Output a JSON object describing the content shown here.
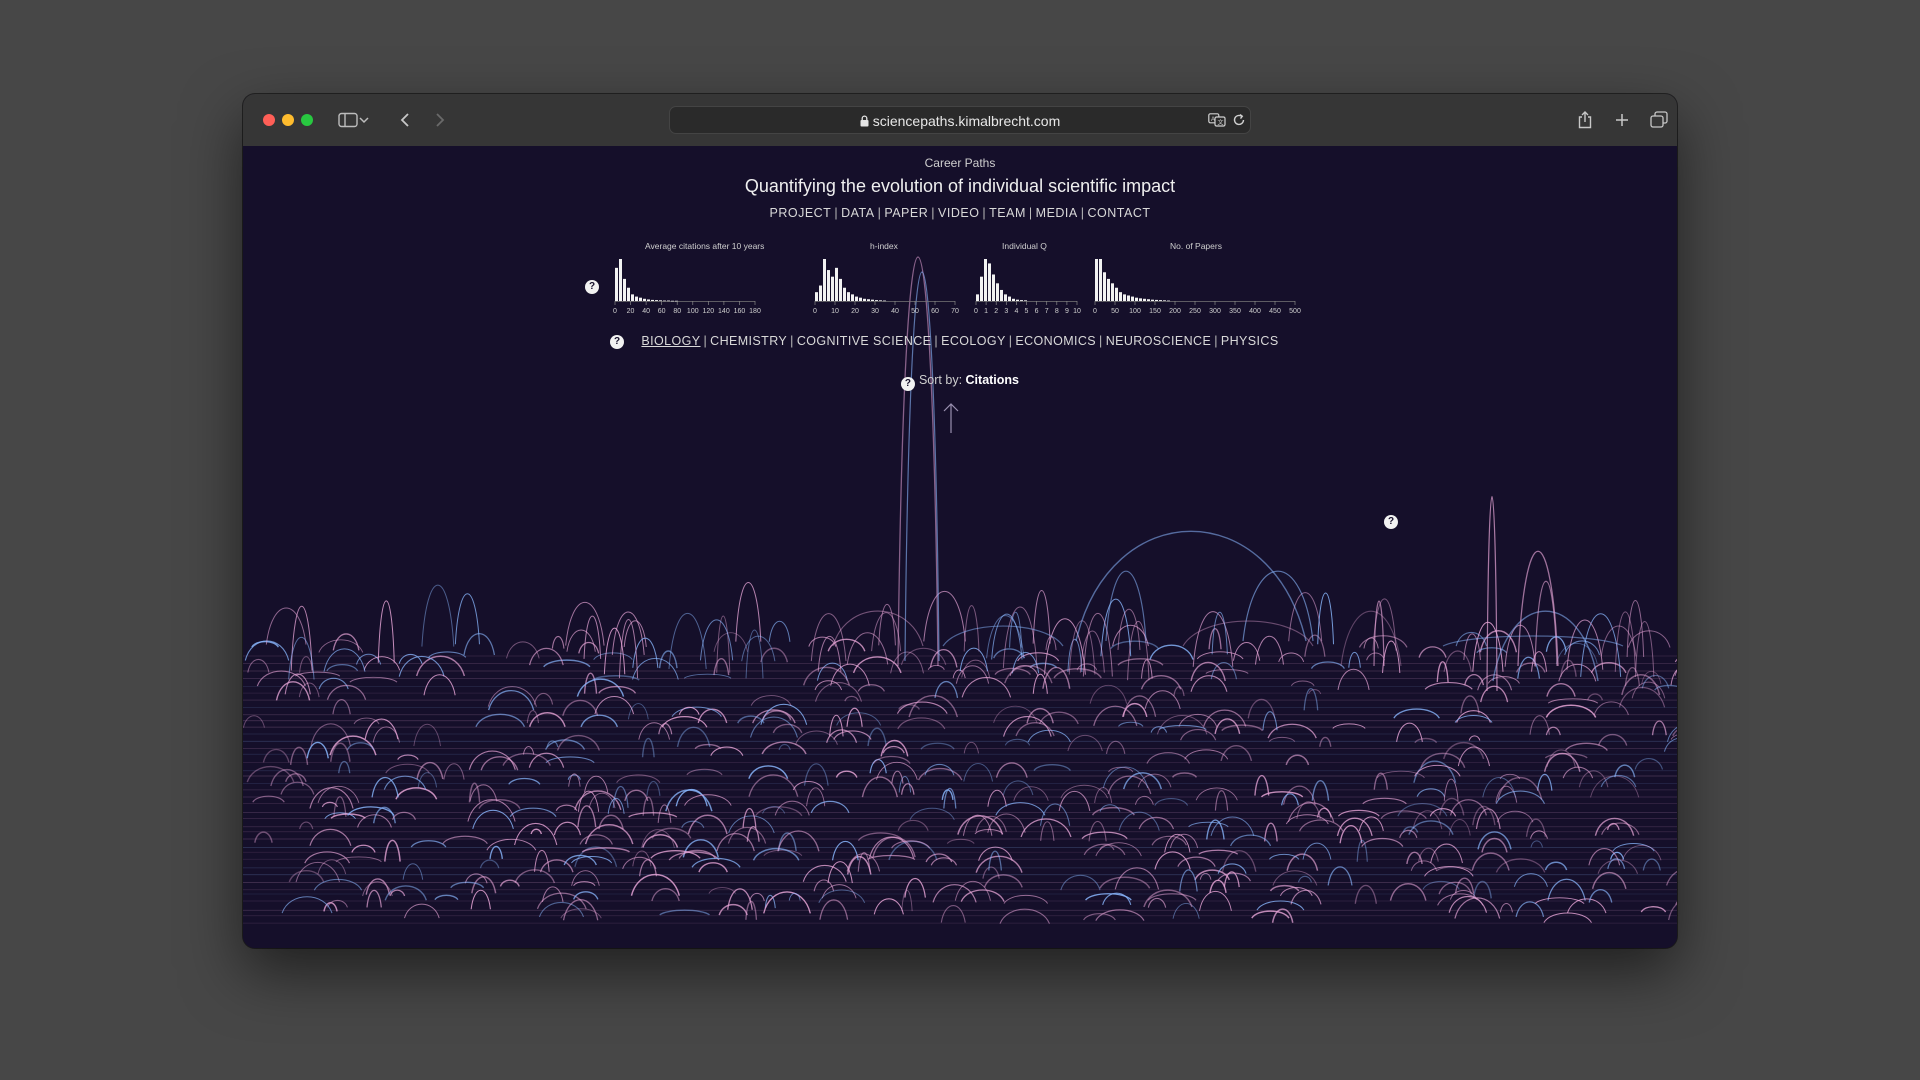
{
  "browser": {
    "url": "sciencepaths.kimalbrecht.com",
    "traffic_lights": {
      "close": "#ff5f57",
      "minimize": "#febc2e",
      "zoom": "#28c840"
    },
    "toolbar_icons": [
      "sidebar-icon",
      "chevron-down-icon",
      "back-icon",
      "forward-icon",
      "translate-icon",
      "reload-icon",
      "share-icon",
      "new-tab-icon",
      "tabs-overview-icon"
    ]
  },
  "page": {
    "kicker": "Career Paths",
    "title": "Quantifying the evolution of individual scientific impact",
    "nav": [
      "PROJECT",
      "DATA",
      "PAPER",
      "VIDEO",
      "TEAM",
      "MEDIA",
      "CONTACT"
    ],
    "fields": [
      "BIOLOGY",
      "CHEMISTRY",
      "COGNITIVE SCIENCE",
      "ECOLOGY",
      "ECONOMICS",
      "NEUROSCIENCE",
      "PHYSICS"
    ],
    "active_field": "BIOLOGY",
    "sort_label": "Sort by:",
    "sort_value": "Citations",
    "help_glyph": "?",
    "colors": {
      "background": "#150f2a",
      "arc_pink": "#e8a6d8",
      "arc_blue": "#8ab8ff",
      "text": "#d9d9d9"
    }
  },
  "chart_data": [
    {
      "type": "bar",
      "title": "Average citations after 10 years",
      "tick_labels": [
        "0",
        "20",
        "40",
        "60",
        "80",
        "100",
        "120",
        "140",
        "160",
        "180"
      ],
      "xlim": [
        0,
        180
      ],
      "values": [
        15,
        19,
        10,
        6,
        3,
        2,
        1.5,
        1,
        0.7,
        0.5,
        0.4,
        0.3,
        0.2,
        0.2,
        0.1,
        0.1
      ]
    },
    {
      "type": "bar",
      "title": "h-index",
      "tick_labels": [
        "0",
        "10",
        "20",
        "30",
        "40",
        "50",
        "60",
        "70"
      ],
      "xlim": [
        0,
        70
      ],
      "values": [
        4,
        7,
        19,
        14,
        11,
        15,
        10,
        6,
        4,
        3,
        2,
        1.5,
        1,
        0.8,
        0.6,
        0.4,
        0.3,
        0.2
      ]
    },
    {
      "type": "bar",
      "title": "Individual Q",
      "tick_labels": [
        "0",
        "1",
        "2",
        "3",
        "4",
        "5",
        "6",
        "7",
        "8",
        "9",
        "10"
      ],
      "xlim": [
        0,
        10
      ],
      "values": [
        3,
        11,
        19,
        17,
        12,
        8,
        5,
        3,
        2,
        1,
        0.6,
        0.4,
        0.3
      ]
    },
    {
      "type": "bar",
      "title": "No. of Papers",
      "tick_labels": [
        "0",
        "50",
        "100",
        "150",
        "200",
        "250",
        "300",
        "350",
        "400",
        "450",
        "500"
      ],
      "xlim": [
        0,
        500
      ],
      "values": [
        19,
        19,
        13,
        10,
        8,
        6,
        4,
        3,
        2.5,
        2,
        1.5,
        1.2,
        1,
        0.8,
        0.6,
        0.5,
        0.4,
        0.3,
        0.2
      ]
    }
  ]
}
